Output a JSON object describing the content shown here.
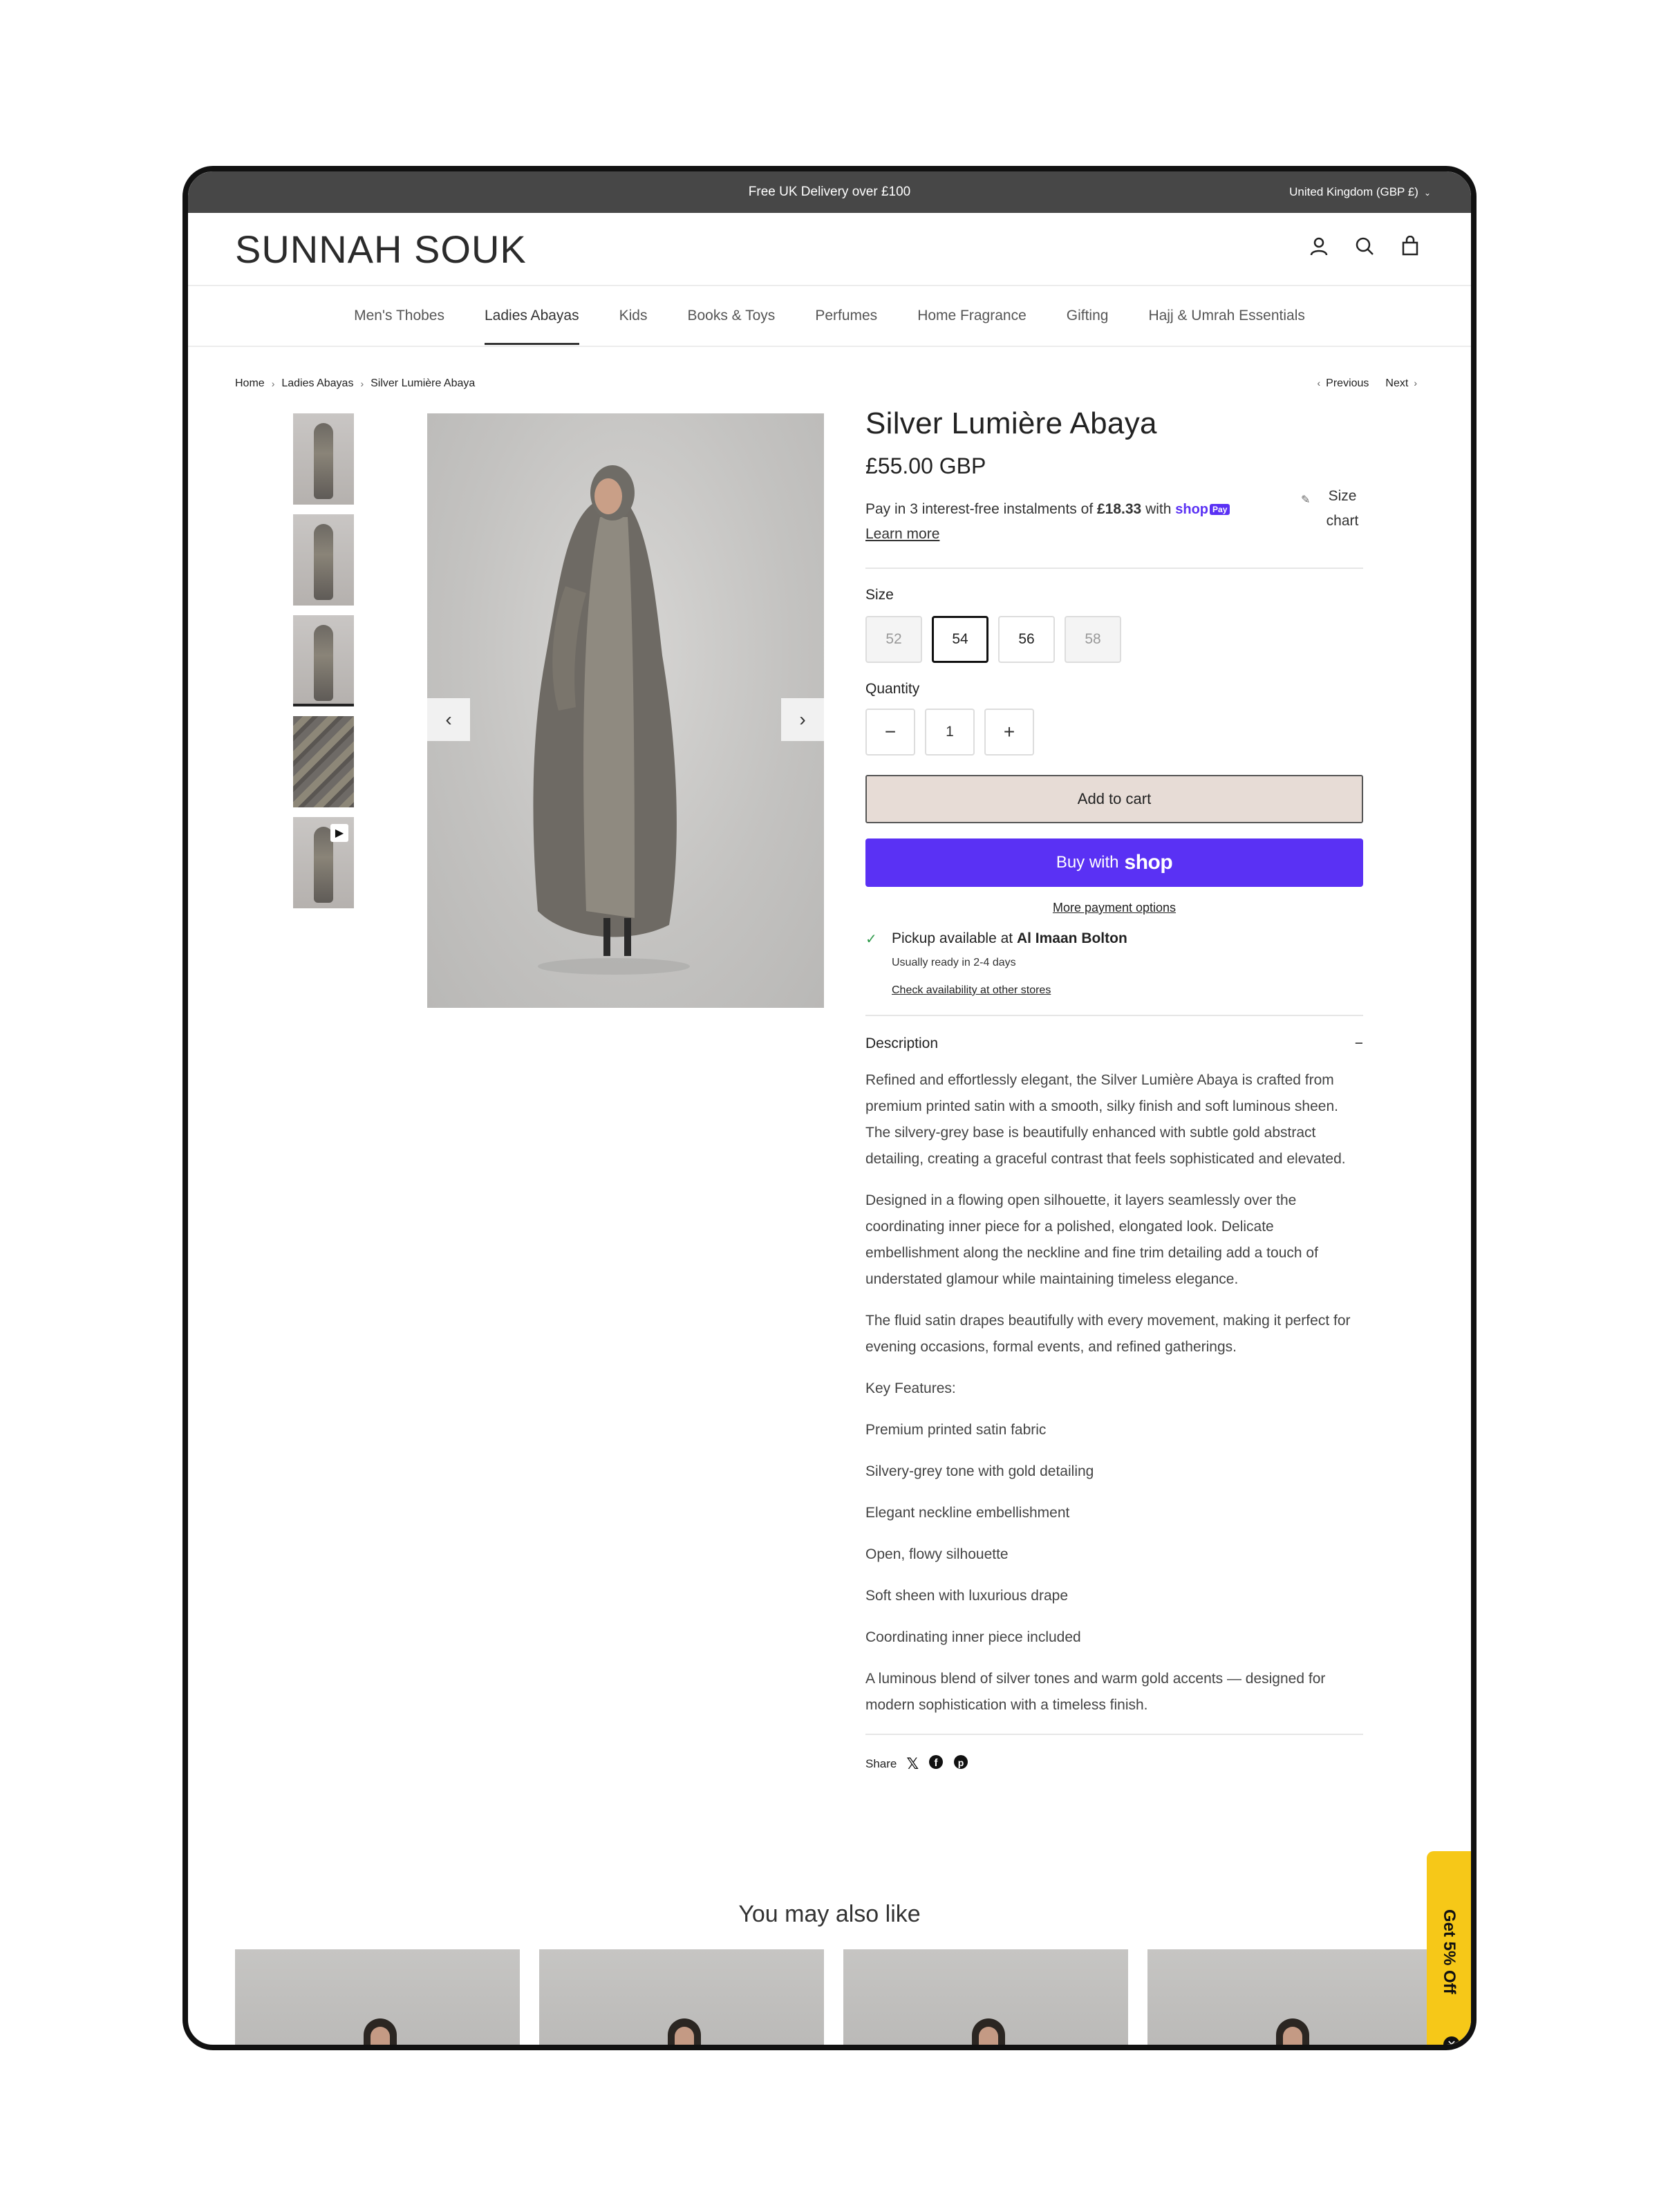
{
  "topbar": {
    "promo": "Free UK Delivery over £100",
    "region": "United Kingdom (GBP £)"
  },
  "header": {
    "logo": "SUNNAH SOUK",
    "icons": [
      "account-icon",
      "search-icon",
      "cart-icon"
    ]
  },
  "nav": {
    "items": [
      "Men's Thobes",
      "Ladies Abayas",
      "Kids",
      "Books & Toys",
      "Perfumes",
      "Home Fragrance",
      "Gifting",
      "Hajj & Umrah Essentials"
    ],
    "active": "Ladies Abayas"
  },
  "breadcrumb": {
    "items": [
      "Home",
      "Ladies Abayas",
      "Silver Lumière Abaya"
    ]
  },
  "pager": {
    "previous": "Previous",
    "next": "Next"
  },
  "product": {
    "title": "Silver Lumière Abaya",
    "price": "£55.00 GBP",
    "installments_prefix": "Pay in 3 interest-free instalments of ",
    "installments_amount": "£18.33",
    "installments_with": " with ",
    "shoppay": "shop",
    "shoppay_badge": "Pay",
    "learn_more": "Learn more",
    "size_chart": "Size chart",
    "size_label": "Size",
    "sizes": [
      {
        "label": "52",
        "state": "disabled"
      },
      {
        "label": "54",
        "state": "selected"
      },
      {
        "label": "56",
        "state": "available"
      },
      {
        "label": "58",
        "state": "disabled"
      }
    ],
    "quantity_label": "Quantity",
    "quantity": "1",
    "add_to_cart": "Add to cart",
    "buy_with": "Buy with",
    "buy_shop": "shop",
    "more_payment": "More payment options",
    "pickup_prefix": "Pickup available at ",
    "pickup_store": "Al Imaan Bolton",
    "pickup_ready": "Usually ready in 2-4 days",
    "check_availability": "Check availability at other stores",
    "description_label": "Description",
    "description": [
      "Refined and effortlessly elegant, the Silver Lumière Abaya is crafted from premium printed satin with a smooth, silky finish and soft luminous sheen. The silvery-grey base is beautifully enhanced with subtle gold abstract detailing, creating a graceful contrast that feels sophisticated and elevated.",
      "Designed in a flowing open silhouette, it layers seamlessly over the coordinating inner piece for a polished, elongated look. Delicate embellishment along the neckline and fine trim detailing add a touch of understated glamour while maintaining timeless elegance.",
      "The fluid satin drapes beautifully with every movement, making it perfect for evening occasions, formal events, and refined gatherings.",
      "Key Features:",
      "Premium printed satin fabric",
      "Silvery-grey tone with gold detailing",
      "Elegant neckline embellishment",
      "Open, flowy silhouette",
      "Soft sheen with luxurious drape",
      "Coordinating inner piece included",
      "A luminous blend of silver tones and warm gold accents — designed for modern sophistication with a timeless finish."
    ],
    "share_label": "Share",
    "share_icons": [
      "x-icon",
      "facebook-icon",
      "pinterest-icon"
    ]
  },
  "related": {
    "title": "You may also like"
  },
  "promo_tab": {
    "label": "Get 5% Off"
  },
  "colors": {
    "topbar": "#474747",
    "shop_pay": "#5a31f4",
    "add_to_cart": "#e7dcd6",
    "promo": "#f6c818",
    "check": "#2e9a4a"
  }
}
